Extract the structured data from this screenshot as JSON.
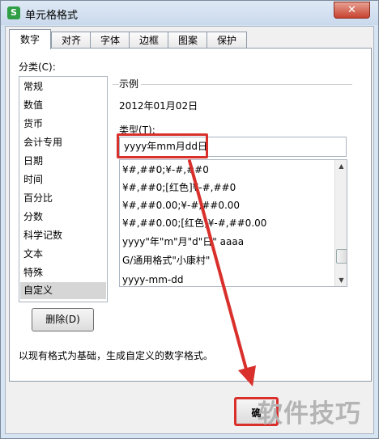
{
  "window": {
    "title": "单元格格式",
    "app_icon": "S",
    "close": "✕"
  },
  "tabs": [
    {
      "label": "数字",
      "active": true
    },
    {
      "label": "对齐"
    },
    {
      "label": "字体"
    },
    {
      "label": "边框"
    },
    {
      "label": "图案"
    },
    {
      "label": "保护"
    }
  ],
  "category": {
    "label": "分类(C):",
    "items": [
      "常规",
      "数值",
      "货币",
      "会计专用",
      "日期",
      "时间",
      "百分比",
      "分数",
      "科学记数",
      "文本",
      "特殊",
      "自定义"
    ],
    "selected": "自定义"
  },
  "sample": {
    "label": "示例",
    "value": "2012年01月02日"
  },
  "type": {
    "label": "类型(T):",
    "value": "yyyy年mm月dd日",
    "formats": [
      "¥#,##0;¥-#,##0",
      "¥#,##0;[红色]¥-#,##0",
      "¥#,##0.00;¥-#,##0.00",
      "¥#,##0.00;[红色]¥-#,##0.00",
      "yyyy\"年\"m\"月\"d\"日\" aaaa",
      "G/通用格式\"小康村\"",
      "yyyy-mm-dd"
    ]
  },
  "buttons": {
    "delete": "删除(D)",
    "ok": "确"
  },
  "description": "以现有格式为基础，生成自定义的数字格式。",
  "watermark": "软件技巧",
  "colors": {
    "highlight": "#d9302c",
    "title_bg": "#dfe9f5"
  }
}
